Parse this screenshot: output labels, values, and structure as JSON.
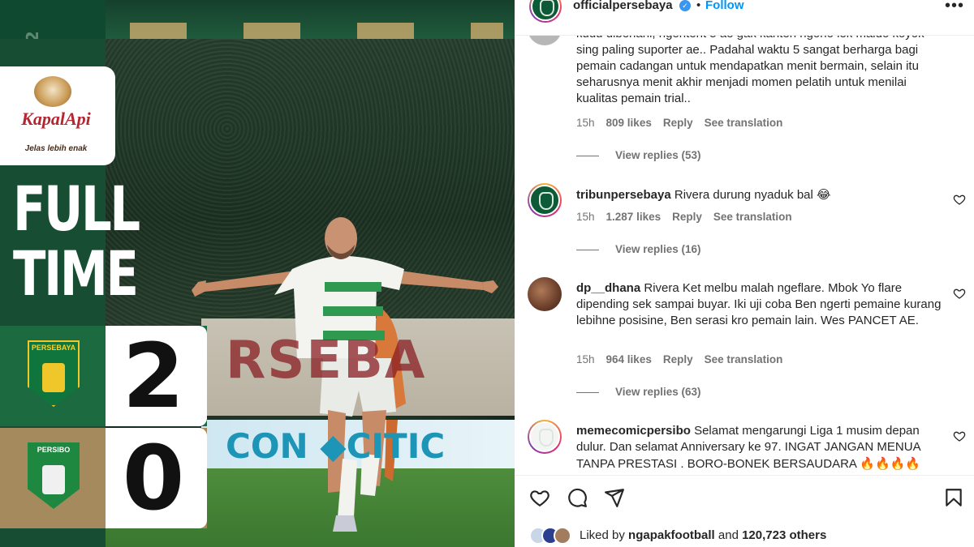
{
  "post_image": {
    "sponsor_name": "KapalApi",
    "sponsor_tagline": "Jelas lebih enak",
    "headline_line1": "FULL",
    "headline_line2": "TIME",
    "home_team": {
      "name": "PERSEBAYA",
      "score": "2"
    },
    "away_team": {
      "name": "PERSIBO",
      "score": "0"
    },
    "colors": {
      "panel_green": "#174d33",
      "home_row": "#1c6a40",
      "away_row": "#a48a5c"
    }
  },
  "header": {
    "username": "officialpersebaya",
    "separator": "•",
    "follow_label": "Follow",
    "more_label": "•••"
  },
  "comments": [
    {
      "username": "",
      "text": "kudu dibenahi, ngentent 5 ae gak kanten ngono lek maido koyok sing paling suporter ae.. Padahal waktu 5 sangat berharga bagi pemain cadangan untuk mendapatkan menit bermain, selain itu seharusnya menit akhir menjadi momen pelatih untuk menilai kualitas pemain trial..",
      "time": "15h",
      "likes": "809 likes",
      "reply": "Reply",
      "translate": "See translation",
      "replies": "View replies (53)"
    },
    {
      "username": "tribunpersebaya",
      "text": "Rivera durung nyaduk bal",
      "emoji": "😂",
      "time": "15h",
      "likes": "1.287 likes",
      "reply": "Reply",
      "translate": "See translation",
      "replies": "View replies (16)"
    },
    {
      "username": "dp__dhana",
      "text": "Rivera Ket melbu malah ngeflare. Mbok Yo flare dipending sek sampai buyar. Iki uji coba Ben ngerti pemaine kurang lebihne posisine, Ben serasi kro pemain lain. Wes PANCET AE.",
      "time": "15h",
      "likes": "964 likes",
      "reply": "Reply",
      "translate": "See translation",
      "replies": "View replies (63)"
    },
    {
      "username": "memecomicpersibo",
      "text": "Selamat mengarungi Liga 1 musim depan dulur. Dan selamat Anniversary ke 97. INGAT JANGAN MENUA TANPA PRESTASI . BORO-BONEK BERSAUDARA",
      "emoji": "🔥🔥🔥🔥"
    }
  ],
  "actions": {
    "liked_by_prefix": "Liked by",
    "liked_by_user": "ngapakfootball",
    "liked_by_and": "and",
    "liked_by_others": "120,723 others"
  }
}
